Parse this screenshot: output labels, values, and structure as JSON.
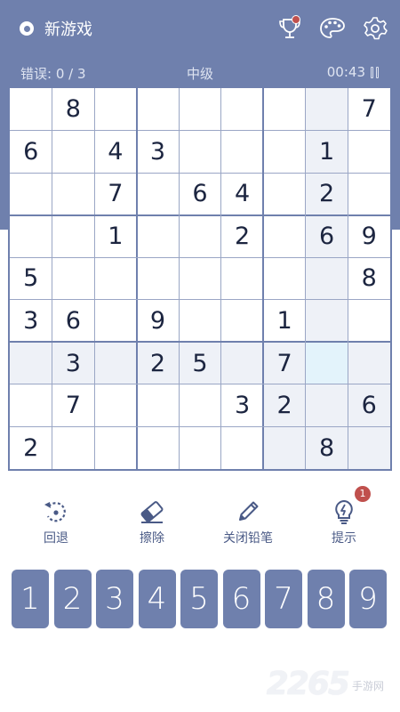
{
  "header": {
    "new_game_label": "新游戏",
    "icons": [
      "radio-icon",
      "trophy-icon",
      "palette-icon",
      "gear-icon"
    ]
  },
  "status": {
    "errors": "错误: 0 / 3",
    "difficulty": "中级",
    "timer": "00:43"
  },
  "board": {
    "grid": [
      [
        "",
        "8",
        "",
        "",
        "",
        "",
        "",
        "",
        "7"
      ],
      [
        "6",
        "",
        "4",
        "3",
        "",
        "",
        "",
        "1",
        ""
      ],
      [
        "",
        "",
        "7",
        "",
        "6",
        "4",
        "",
        "2",
        ""
      ],
      [
        "",
        "",
        "1",
        "",
        "",
        "2",
        "",
        "6",
        "9"
      ],
      [
        "5",
        "",
        "",
        "",
        "",
        "",
        "",
        "",
        "8"
      ],
      [
        "3",
        "6",
        "",
        "9",
        "",
        "",
        "1",
        "",
        ""
      ],
      [
        "",
        "3",
        "",
        "2",
        "5",
        "",
        "7",
        "",
        ""
      ],
      [
        "",
        "7",
        "",
        "",
        "",
        "3",
        "2",
        "",
        "6"
      ],
      [
        "2",
        "",
        "",
        "",
        "",
        "",
        "",
        "8",
        ""
      ]
    ],
    "selected": {
      "row": 6,
      "col": 7
    },
    "colors": {
      "highlight": "#eef1f7",
      "selected": "#e3f3fb"
    }
  },
  "controls": {
    "undo_label": "回退",
    "erase_label": "擦除",
    "pencil_label": "关闭铅笔",
    "hint_label": "提示",
    "hint_count": "1"
  },
  "numpad": [
    "1",
    "2",
    "3",
    "4",
    "5",
    "6",
    "7",
    "8",
    "9"
  ],
  "watermark": {
    "number": "2265",
    "text": "手游网"
  },
  "colors": {
    "primary": "#6f80ad",
    "badge": "#c0504d"
  }
}
